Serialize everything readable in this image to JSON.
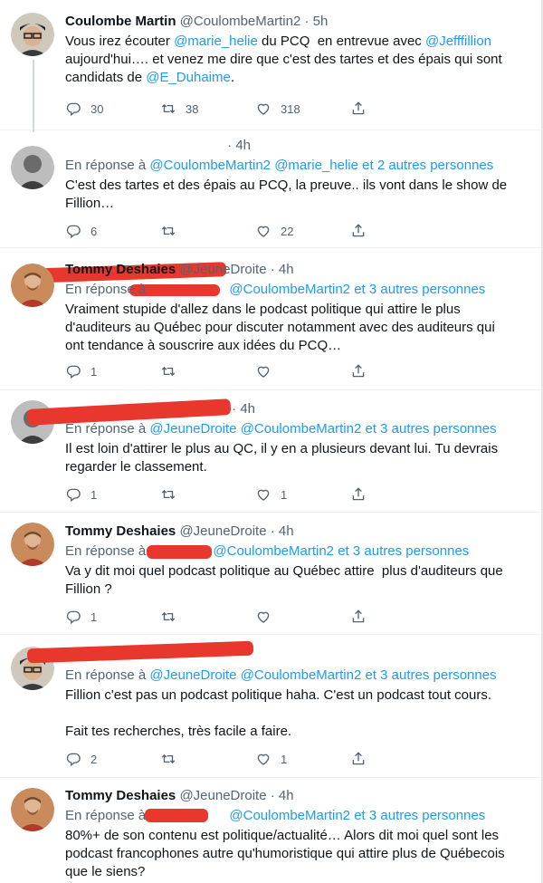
{
  "tweets": [
    {
      "name": "Coulombe Martin",
      "handle": "@CoulombeMartin2",
      "time": "5h",
      "reply_prefix": "",
      "reply_to": [],
      "reply_suffix": "",
      "segments": [
        {
          "t": "Vous irez écouter ",
          "link": false
        },
        {
          "t": "@marie_helie",
          "link": true
        },
        {
          "t": " du PCQ  en entrevue avec ",
          "link": false
        },
        {
          "t": "@Jefffillion",
          "link": true
        },
        {
          "t": "\naujourd'hui…. et venez me dire que c'est des tartes et des épais qui sont\ncandidats de ",
          "link": false
        },
        {
          "t": "@E_Duhaime",
          "link": true
        },
        {
          "t": ".",
          "link": false
        }
      ],
      "counts": {
        "reply": "30",
        "retweet": "38",
        "like": "318"
      }
    },
    {
      "name": "",
      "handle": "",
      "time": "4h",
      "reply_prefix": "En réponse à ",
      "reply_to": [
        "@CoulombeMartin2",
        "@marie_helie"
      ],
      "reply_suffix": "et 2 autres personnes",
      "segments": [
        {
          "t": "C'est des tartes et des épais au PCQ, la preuve.. ils vont dans le show de\nFillion…",
          "link": false
        }
      ],
      "counts": {
        "reply": "6",
        "retweet": "",
        "like": "22"
      }
    },
    {
      "name": "Tommy Deshaies",
      "handle": "@JeuneDroite",
      "time": "4h",
      "reply_prefix": "En réponse à ",
      "reply_to": [
        "@CoulombeMartin2"
      ],
      "reply_suffix": "et 3 autres personnes",
      "segments": [
        {
          "t": "Vraiment stupide d'allez dans le podcast politique qui attire le plus\nd'auditeurs au Québec pour discuter notamment avec des auditeurs qui\nont tendance à souscrire aux idées du PCQ…",
          "link": false
        }
      ],
      "counts": {
        "reply": "1",
        "retweet": "",
        "like": ""
      }
    },
    {
      "name": "",
      "handle": "",
      "time": "4h",
      "reply_prefix": "En réponse à ",
      "reply_to": [
        "@JeuneDroite",
        "@CoulombeMartin2"
      ],
      "reply_suffix": "et 3 autres personnes",
      "segments": [
        {
          "t": "Il est loin d'attirer le plus au QC, il y en a plusieurs devant lui. Tu devrais\nregarder le classement.",
          "link": false
        }
      ],
      "counts": {
        "reply": "1",
        "retweet": "",
        "like": "1"
      }
    },
    {
      "name": "Tommy Deshaies",
      "handle": "@JeuneDroite",
      "time": "4h",
      "reply_prefix": "En réponse à ",
      "reply_to": [
        "@CoulombeMartin2"
      ],
      "reply_suffix": "et 3 autres personnes",
      "segments": [
        {
          "t": "Va y dit moi quel podcast politique au Québec attire  plus d'auditeurs que\nFillion ?",
          "link": false
        }
      ],
      "counts": {
        "reply": "1",
        "retweet": "",
        "like": ""
      }
    },
    {
      "name": "",
      "handle": "",
      "time": "",
      "reply_prefix": "En réponse à ",
      "reply_to": [
        "@JeuneDroite",
        "@CoulombeMartin2"
      ],
      "reply_suffix": "et 3 autres personnes",
      "segments": [
        {
          "t": "Fillion c'est pas un podcast politique haha. C'est un podcast tout cours.\n\nFait tes recherches, très facile a faire.",
          "link": false
        }
      ],
      "counts": {
        "reply": "2",
        "retweet": "",
        "like": "1"
      }
    },
    {
      "name": "Tommy Deshaies",
      "handle": "@JeuneDroite",
      "time": "4h",
      "reply_prefix": "En réponse à ",
      "reply_to": [
        "@CoulombeMartin2"
      ],
      "reply_suffix": "et 3 autres personnes",
      "segments": [
        {
          "t": "80%+ de son contenu est politique/actualité… Alors dit moi quel sont les\npodcast francophones autre qu'humoristique qui attire plus de Québecois\nque le siens?",
          "link": false
        }
      ],
      "counts": {
        "reply": "",
        "retweet": "",
        "like": ""
      }
    }
  ],
  "icons": {
    "reply": "reply-icon",
    "retweet": "retweet-icon",
    "like": "like-icon",
    "share": "share-icon"
  },
  "colors": {
    "link": "#1d9bf0",
    "muted": "#536471",
    "redaction": "#e8382e"
  }
}
